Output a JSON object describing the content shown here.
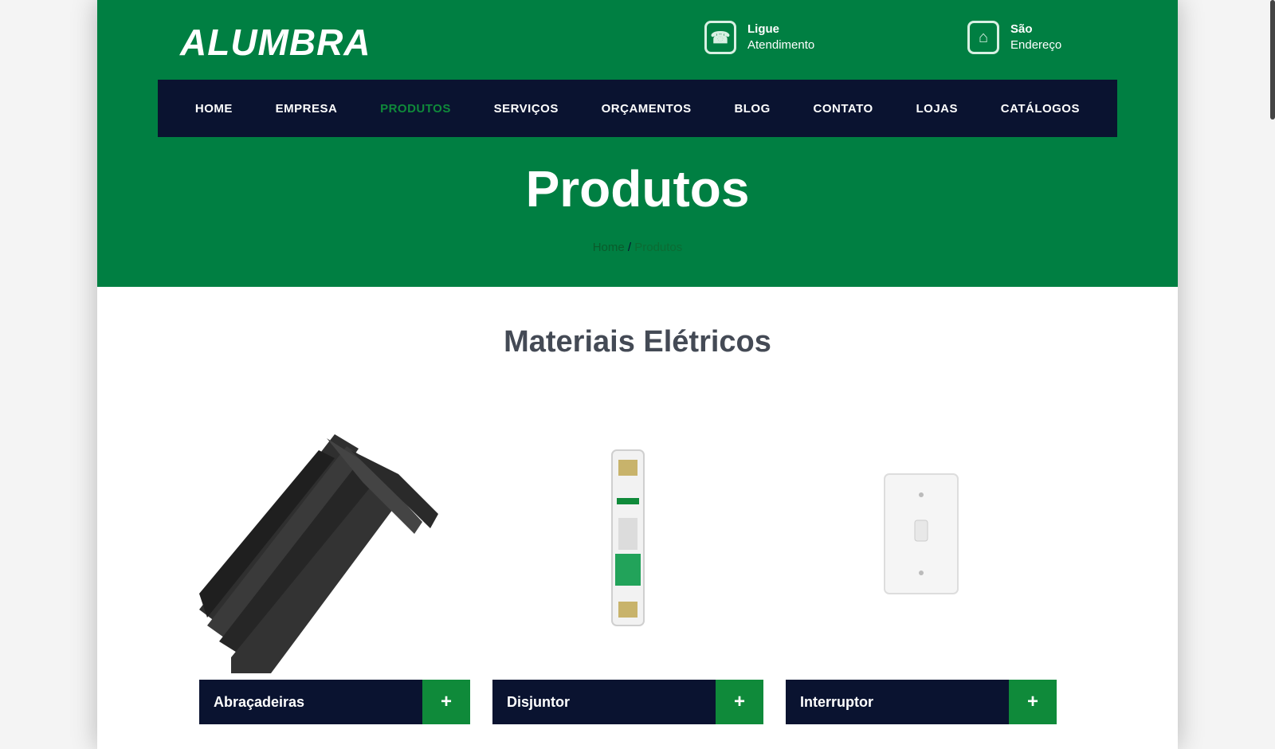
{
  "header": {
    "logo": "ALUMBRA",
    "contacts": [
      {
        "icon": "phone-icon",
        "title": "Ligue",
        "subtitle": "Atendimento"
      },
      {
        "icon": "location-icon",
        "title": "São",
        "subtitle": "Endereço"
      }
    ]
  },
  "nav": {
    "items": [
      {
        "label": "Home"
      },
      {
        "label": "Empresa"
      },
      {
        "label": "Produtos"
      },
      {
        "label": "Serviços"
      },
      {
        "label": "Orçamentos"
      },
      {
        "label": "Blog"
      },
      {
        "label": "Contato"
      },
      {
        "label": "Lojas"
      },
      {
        "label": "Catálogos"
      }
    ],
    "active_index": 2
  },
  "hero": {
    "title": "Produtos",
    "breadcrumb": {
      "home": "Home",
      "separator": "/",
      "current": "Produtos"
    }
  },
  "section": {
    "title": "Materiais Elétricos"
  },
  "products": [
    {
      "label": "Abraçadeiras",
      "image_icon": "cable-ties-icon",
      "button_icon": "plus-icon"
    },
    {
      "label": "Disjuntor",
      "image_icon": "circuit-breaker-icon",
      "button_icon": "plus-icon"
    },
    {
      "label": "Interruptor",
      "image_icon": "wall-switch-icon",
      "button_icon": "plus-icon"
    }
  ],
  "colors": {
    "brand_green": "#007f42",
    "nav_dark": "#0a1330",
    "accent_green": "#0f8a3a"
  }
}
